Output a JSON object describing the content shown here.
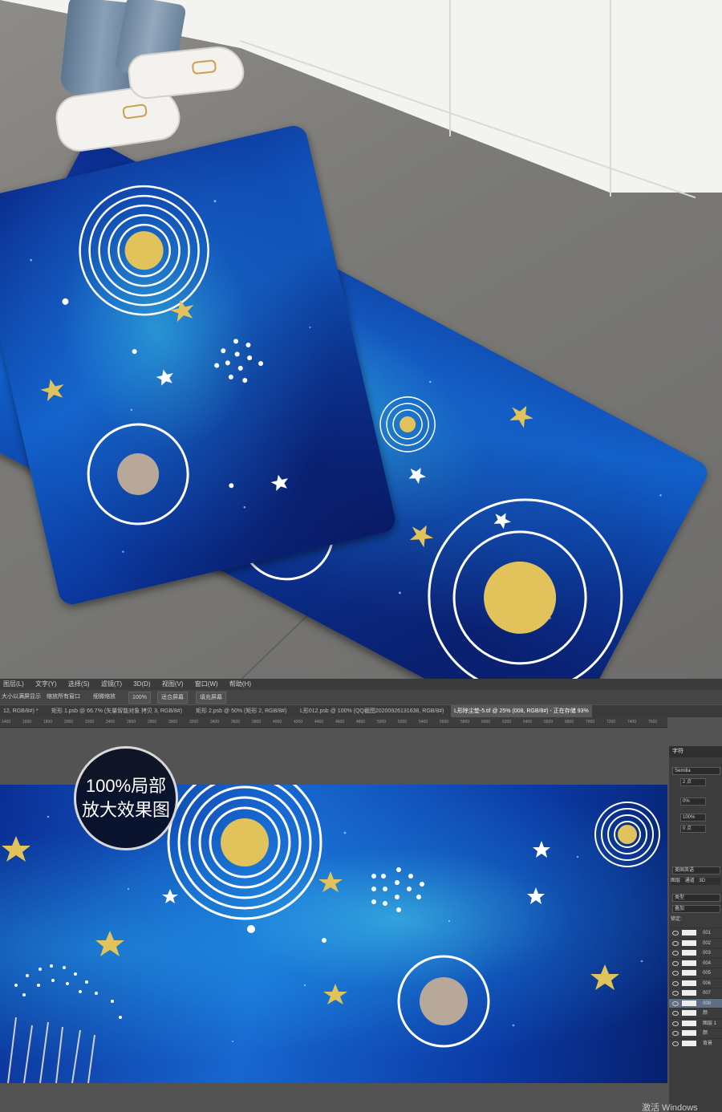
{
  "badge": {
    "line1": "100%局部",
    "line2": "放大效果图"
  },
  "ps": {
    "menu": [
      "图层(L)",
      "文字(Y)",
      "选择(S)",
      "滤镜(T)",
      "3D(D)",
      "视图(V)",
      "窗口(W)",
      "帮助(H)"
    ],
    "options": [
      "大小以满屏显示",
      "缩放所有窗口",
      "细微缩放",
      "100%",
      "适合屏幕",
      "填充屏幕"
    ],
    "tabs": [
      "12, RGB/8#) *",
      "矩形 1.psb @ 66.7% (矢量智能对象 拷贝 3, RGB/8#)",
      "矩形 2.psb @ 50% (矩形 2, RGB/8#)",
      "L形012.psb @ 100% (QQ截图20200926131638, RGB/8#)",
      "L形除尘垫-5.tif @ 25% (008, RGB/8#) - 正在存储 93%"
    ],
    "ruler": [
      "1400",
      "1600",
      "1800",
      "2000",
      "2200",
      "2400",
      "2600",
      "2800",
      "3000",
      "3200",
      "3400",
      "3600",
      "3800",
      "4000",
      "4200",
      "4400",
      "4600",
      "4800",
      "5000",
      "5200",
      "5400",
      "5600",
      "5800",
      "6000",
      "6200",
      "6400",
      "6600",
      "6800",
      "7000",
      "7200",
      "7400",
      "7600"
    ],
    "panel": {
      "tab_char": "字符",
      "font": "Semilla",
      "size": "2 点",
      "tracking": "0%",
      "scale": "100%",
      "baseline": "0 点",
      "lang": "美国英语",
      "layers_tab": "图层",
      "channels_tab": "通道",
      "threed_tab": "3D",
      "kind": "类型",
      "blend": "叠加",
      "lock": "锁定:",
      "layers": [
        "001",
        "002",
        "003",
        "004",
        "005",
        "006",
        "007",
        "008",
        "颜",
        "图层 1",
        "颜",
        "背景"
      ]
    }
  },
  "watermark": "激活 Windows",
  "colors": {
    "mat_dark": "#0b2a8c",
    "mat_light": "#1767d0",
    "gold": "#e2c25a",
    "ps_bg": "#535353"
  }
}
